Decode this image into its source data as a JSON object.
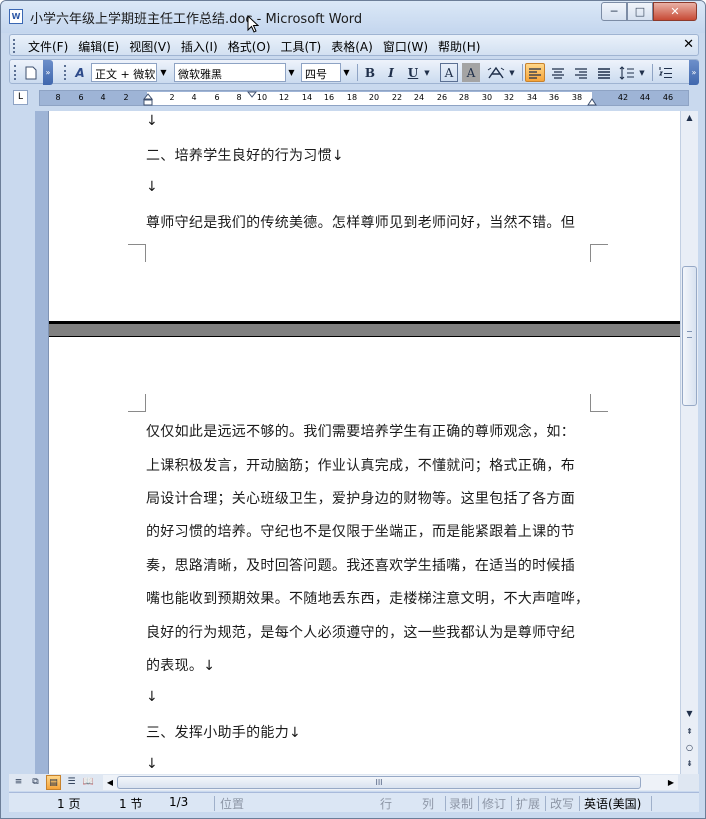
{
  "window": {
    "title": "小学六年级上学期班主任工作总结.doc - Microsoft Word",
    "app_icon": "word-doc-icon",
    "minimize": "─",
    "maximize": "□",
    "close": "✕"
  },
  "menu": {
    "items": [
      "文件(F)",
      "编辑(E)",
      "视图(V)",
      "插入(I)",
      "格式(O)",
      "工具(T)",
      "表格(A)",
      "窗口(W)",
      "帮助(H)"
    ],
    "close": "✕"
  },
  "toolbar": {
    "style_value": "正文 + 微软",
    "font_value": "微软雅黑",
    "size_value": "四号",
    "bold": "B",
    "italic": "I",
    "underline": "U",
    "font_color": "A",
    "char_shading": "A",
    "active_alignment": "left",
    "accent_color": "#f6a43a"
  },
  "ruler": {
    "ticks": [
      "8",
      "6",
      "4",
      "2",
      "2",
      "4",
      "6",
      "8",
      "10",
      "12",
      "14",
      "16",
      "18",
      "20",
      "22",
      "24",
      "26",
      "28",
      "30",
      "32",
      "34",
      "36",
      "38",
      "42",
      "44",
      "46"
    ],
    "corner": "L"
  },
  "document": {
    "page1_lines": [
      "↓",
      "二、培养学生良好的行为习惯↓",
      "↓",
      "尊师守纪是我们的传统美德。怎样尊师见到老师问好，当然不错。但"
    ],
    "page2_lines": [
      "仅仅如此是远远不够的。我们需要培养学生有正确的尊师观念，如：",
      "上课积极发言，开动脑筋；作业认真完成，不懂就问；格式正确，布",
      "局设计合理；关心班级卫生，爱护身边的财物等。这里包括了各方面",
      "的好习惯的培养。守纪也不是仅限于坐端正，而是能紧跟着上课的节",
      "奏，思路清晰，及时回答问题。我还喜欢学生插嘴，在适当的时候插",
      "嘴也能收到预期效果。不随地丢东西，走楼梯注意文明，不大声喧哗，",
      "良好的行为规范，是每个人必须遵守的，这一些我都认为是尊师守纪",
      "的表现。↓",
      "↓",
      "三、发挥小助手的能力↓",
      "↓"
    ]
  },
  "statusbar": {
    "page": "1 页",
    "section": "1 节",
    "page_of": "1/3",
    "position": "位置",
    "line": "行",
    "column": "列",
    "rec": "录制",
    "trk": "修订",
    "ext": "扩展",
    "ovr": "改写",
    "language": "英语(美国)"
  }
}
